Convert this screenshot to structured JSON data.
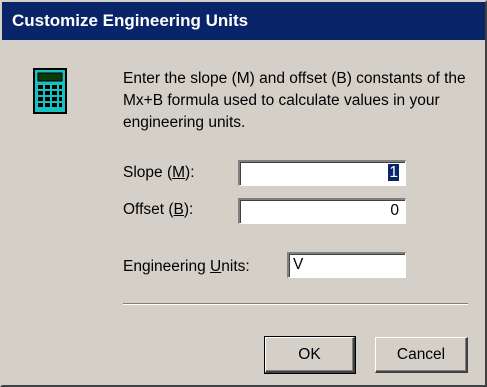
{
  "window": {
    "title": "Customize Engineering Units"
  },
  "intro": {
    "text": "Enter the slope (M) and offset (B) constants of the Mx+B formula used to calculate values in your engineering units."
  },
  "slope": {
    "label_pre": "Slope (",
    "label_key": "M",
    "label_post": "):",
    "value": "1"
  },
  "offset": {
    "label_pre": "Offset (",
    "label_key": "B",
    "label_post": "):",
    "value": "0"
  },
  "units": {
    "label_pre": "Engineering ",
    "label_key": "U",
    "label_post": "nits:",
    "value": "V"
  },
  "buttons": {
    "ok": "OK",
    "cancel": "Cancel"
  },
  "icons": {
    "dialog_icon": "calculator-icon"
  },
  "colors": {
    "titlebar": "#0a246a",
    "dialog_bg": "#d4d0c8",
    "icon_body": "#19c0c0"
  }
}
